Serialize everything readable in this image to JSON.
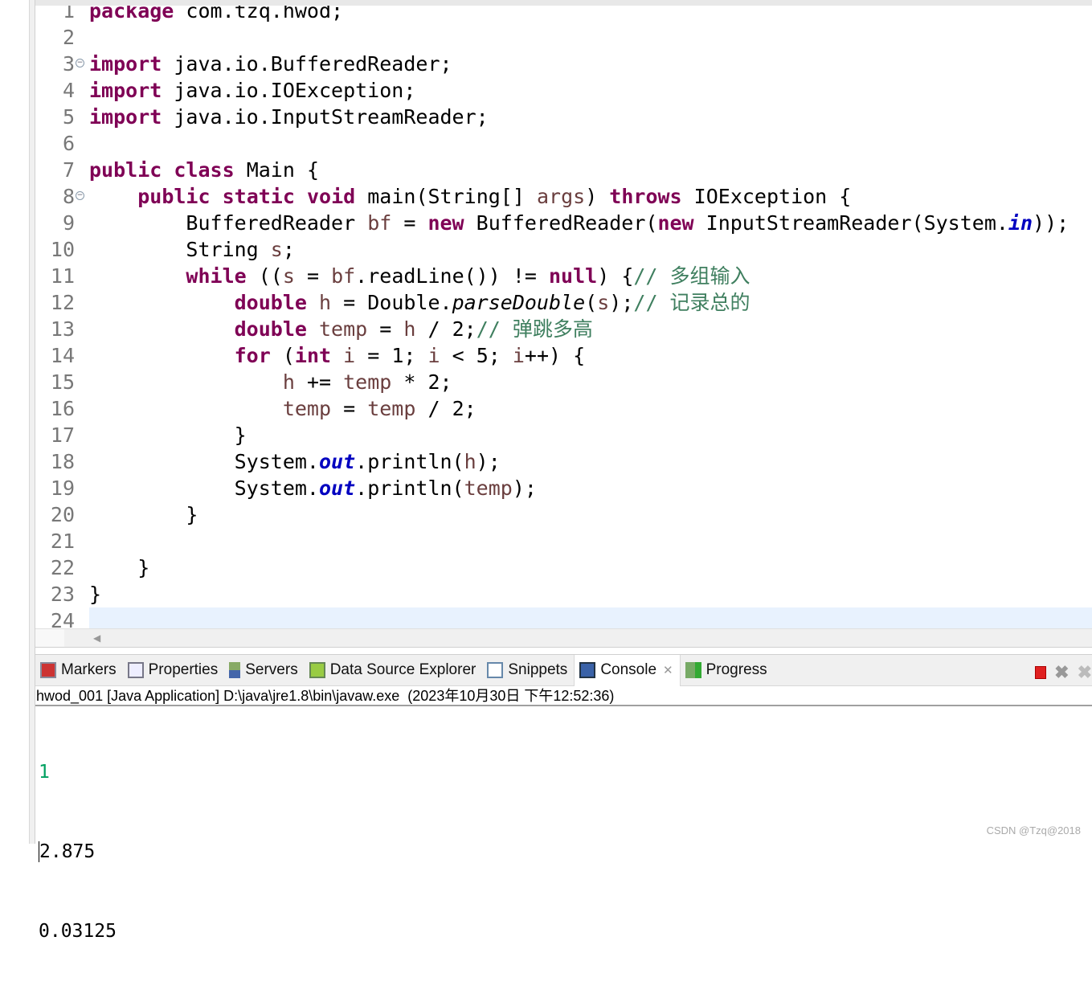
{
  "editor": {
    "current_line": 24,
    "lines": [
      [
        [
          "package",
          "kw"
        ],
        [
          " com.tzq.hwod;",
          ""
        ]
      ],
      [],
      [
        [
          "import",
          "kw"
        ],
        [
          " java.io.BufferedReader;",
          ""
        ]
      ],
      [
        [
          "import",
          "kw"
        ],
        [
          " java.io.IOException;",
          ""
        ]
      ],
      [
        [
          "import",
          "kw"
        ],
        [
          " java.io.InputStreamReader;",
          ""
        ]
      ],
      [],
      [
        [
          "public",
          "kw"
        ],
        [
          " ",
          ""
        ],
        [
          "class",
          "kw"
        ],
        [
          " Main {",
          ""
        ]
      ],
      [
        [
          "    ",
          ""
        ],
        [
          "public",
          "kw"
        ],
        [
          " ",
          ""
        ],
        [
          "static",
          "kw"
        ],
        [
          " ",
          ""
        ],
        [
          "void",
          "kw"
        ],
        [
          " main(String[] ",
          ""
        ],
        [
          "args",
          "var"
        ],
        [
          ") ",
          ""
        ],
        [
          "throws",
          "kw"
        ],
        [
          " IOException {",
          ""
        ]
      ],
      [
        [
          "        BufferedReader ",
          ""
        ],
        [
          "bf",
          "var"
        ],
        [
          " = ",
          ""
        ],
        [
          "new",
          "kw"
        ],
        [
          " BufferedReader(",
          ""
        ],
        [
          "new",
          "kw"
        ],
        [
          " InputStreamReader(System.",
          ""
        ],
        [
          "in",
          "sf"
        ],
        [
          "));",
          ""
        ]
      ],
      [
        [
          "        String ",
          ""
        ],
        [
          "s",
          "var"
        ],
        [
          ";",
          ""
        ]
      ],
      [
        [
          "        ",
          ""
        ],
        [
          "while",
          "kw"
        ],
        [
          " ((",
          ""
        ],
        [
          "s",
          "var"
        ],
        [
          " = ",
          ""
        ],
        [
          "bf",
          "var"
        ],
        [
          ".readLine()) != ",
          ""
        ],
        [
          "null",
          "kw"
        ],
        [
          ") {",
          ""
        ],
        [
          "// 多组输入",
          "cm"
        ]
      ],
      [
        [
          "            ",
          ""
        ],
        [
          "double",
          "kw"
        ],
        [
          " ",
          ""
        ],
        [
          "h",
          "var"
        ],
        [
          " = Double.",
          ""
        ],
        [
          "parseDouble",
          "sm"
        ],
        [
          "(",
          ""
        ],
        [
          "s",
          "var"
        ],
        [
          ");",
          ""
        ],
        [
          "// 记录总的",
          "cm"
        ]
      ],
      [
        [
          "            ",
          ""
        ],
        [
          "double",
          "kw"
        ],
        [
          " ",
          ""
        ],
        [
          "temp",
          "var"
        ],
        [
          " = ",
          ""
        ],
        [
          "h",
          "var"
        ],
        [
          " / 2;",
          ""
        ],
        [
          "// 弹跳多高",
          "cm"
        ]
      ],
      [
        [
          "            ",
          ""
        ],
        [
          "for",
          "kw"
        ],
        [
          " (",
          ""
        ],
        [
          "int",
          "kw"
        ],
        [
          " ",
          ""
        ],
        [
          "i",
          "var"
        ],
        [
          " = 1; ",
          ""
        ],
        [
          "i",
          "var"
        ],
        [
          " < 5; ",
          ""
        ],
        [
          "i",
          "var"
        ],
        [
          "++) {",
          ""
        ]
      ],
      [
        [
          "                ",
          ""
        ],
        [
          "h",
          "var"
        ],
        [
          " += ",
          ""
        ],
        [
          "temp",
          "var"
        ],
        [
          " * 2;",
          ""
        ]
      ],
      [
        [
          "                ",
          ""
        ],
        [
          "temp",
          "var"
        ],
        [
          " = ",
          ""
        ],
        [
          "temp",
          "var"
        ],
        [
          " / 2;",
          ""
        ]
      ],
      [
        [
          "            }",
          ""
        ]
      ],
      [
        [
          "            System.",
          ""
        ],
        [
          "out",
          "sf"
        ],
        [
          ".println(",
          ""
        ],
        [
          "h",
          "var"
        ],
        [
          ");",
          ""
        ]
      ],
      [
        [
          "            System.",
          ""
        ],
        [
          "out",
          "sf"
        ],
        [
          ".println(",
          ""
        ],
        [
          "temp",
          "var"
        ],
        [
          ");",
          ""
        ]
      ],
      [
        [
          "        }",
          ""
        ]
      ],
      [],
      [
        [
          "    }",
          ""
        ]
      ],
      [
        [
          "}",
          ""
        ]
      ],
      []
    ],
    "fold_lines": [
      3,
      8
    ]
  },
  "panel": {
    "tabs": [
      {
        "label": "Markers",
        "icon": "markers-icon"
      },
      {
        "label": "Properties",
        "icon": "properties-icon"
      },
      {
        "label": "Servers",
        "icon": "servers-icon"
      },
      {
        "label": "Data Source Explorer",
        "icon": "data-source-explorer-icon"
      },
      {
        "label": "Snippets",
        "icon": "snippets-icon"
      },
      {
        "label": "Console",
        "icon": "console-icon",
        "active": true
      },
      {
        "label": "Progress",
        "icon": "progress-icon"
      }
    ],
    "console_header": "hwod_001 [Java Application] D:\\java\\jre1.8\\bin\\javaw.exe  (2023年10月30日 下午12:52:36)",
    "input_line": "1",
    "output_lines": [
      "2.875",
      "0.03125"
    ]
  },
  "watermark": "CSDN @Tzq@2018",
  "colors": {
    "keyword": "#7f0055",
    "local_var": "#6a3e3e",
    "comment": "#3f7f5f",
    "static_field": "#0000c0",
    "console_input": "#00a060",
    "current_line": "#e8f2fe"
  }
}
